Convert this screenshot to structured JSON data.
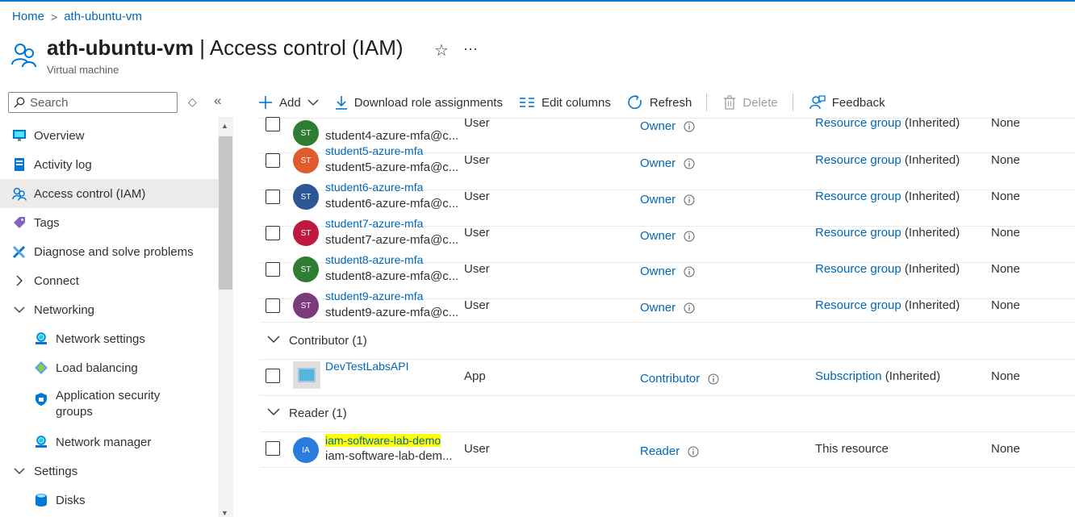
{
  "breadcrumb": {
    "home": "Home",
    "sep": ">",
    "current": "ath-ubuntu-vm"
  },
  "header": {
    "title_resource": "ath-ubuntu-vm",
    "title_rest": " | Access control (IAM)",
    "subtitle": "Virtual machine",
    "star_icon": "star-icon",
    "more": "···"
  },
  "sidebar": {
    "search_placeholder": "Search",
    "collapse": "«",
    "items": [
      {
        "label": "Overview",
        "icon": "monitor-icon"
      },
      {
        "label": "Activity log",
        "icon": "activity-log-icon"
      },
      {
        "label": "Access control (IAM)",
        "icon": "people-icon"
      },
      {
        "label": "Tags",
        "icon": "tag-icon"
      },
      {
        "label": "Diagnose and solve problems",
        "icon": "wrench-icon"
      },
      {
        "label": "Connect",
        "icon": "chevron-right-icon"
      },
      {
        "label": "Networking",
        "icon": "chevron-down-icon"
      },
      {
        "label": "Network settings",
        "icon": "network-icon"
      },
      {
        "label": "Load balancing",
        "icon": "load-balancer-icon"
      },
      {
        "label": "Application security groups",
        "icon": "shield-icon"
      },
      {
        "label": "Network manager",
        "icon": "network-icon"
      },
      {
        "label": "Settings",
        "icon": "chevron-down-icon"
      },
      {
        "label": "Disks",
        "icon": "disk-icon"
      }
    ]
  },
  "toolbar": {
    "add": "Add",
    "download": "Download role assignments",
    "edit_columns": "Edit columns",
    "refresh": "Refresh",
    "delete": "Delete",
    "feedback": "Feedback"
  },
  "rows": [
    {
      "initials": "ST",
      "color": "#2e7d32",
      "name": "",
      "sub": "student4-azure-mfa@c...",
      "type": "User",
      "role": "Owner",
      "scope_link": "Resource group",
      "scope_rest": " (Inherited)",
      "condition": "None"
    },
    {
      "initials": "ST",
      "color": "#e05a2b",
      "name": "student5-azure-mfa",
      "sub": "student5-azure-mfa@c...",
      "type": "User",
      "role": "Owner",
      "scope_link": "Resource group",
      "scope_rest": " (Inherited)",
      "condition": "None"
    },
    {
      "initials": "ST",
      "color": "#2b5797",
      "name": "student6-azure-mfa",
      "sub": "student6-azure-mfa@c...",
      "type": "User",
      "role": "Owner",
      "scope_link": "Resource group",
      "scope_rest": " (Inherited)",
      "condition": "None"
    },
    {
      "initials": "ST",
      "color": "#c0183e",
      "name": "student7-azure-mfa",
      "sub": "student7-azure-mfa@c...",
      "type": "User",
      "role": "Owner",
      "scope_link": "Resource group",
      "scope_rest": " (Inherited)",
      "condition": "None"
    },
    {
      "initials": "ST",
      "color": "#2e7d32",
      "name": "student8-azure-mfa",
      "sub": "student8-azure-mfa@c...",
      "type": "User",
      "role": "Owner",
      "scope_link": "Resource group",
      "scope_rest": " (Inherited)",
      "condition": "None"
    }
  ],
  "row9": {
    "initials": "ST",
    "color": "#7b3a7e",
    "name": "student9-azure-mfa",
    "sub": "student9-azure-mfa@c...",
    "type": "User",
    "role": "Owner",
    "scope_link": "Resource group",
    "scope_rest": " (Inherited)",
    "condition": "None"
  },
  "groups": {
    "contributor": "Contributor (1)",
    "reader": "Reader (1)"
  },
  "contributor_row": {
    "name": "DevTestLabsAPI",
    "type": "App",
    "role": "Contributor",
    "scope_link": "Subscription",
    "scope_rest": " (Inherited)",
    "condition": "None"
  },
  "reader_row": {
    "initials": "IA",
    "color": "#2a7bde",
    "name": "iam-software-lab-demo",
    "sub": "iam-software-lab-dem...",
    "type": "User",
    "role": "Reader",
    "scope": "This resource",
    "condition": "None"
  },
  "colors": {
    "accent": "#0078d4",
    "link": "#0067b8",
    "highlight": "#ffff00"
  }
}
